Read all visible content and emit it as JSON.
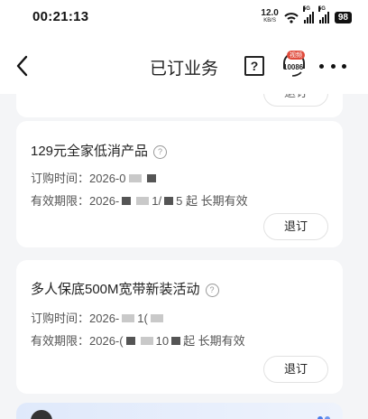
{
  "status_bar": {
    "time": "00:21:13",
    "speed_value": "12.0",
    "speed_unit": "KB/S",
    "sim_tag": "5G",
    "battery": "98"
  },
  "nav": {
    "title": "已订业务",
    "help_label": "?",
    "service_badge": "视频",
    "service_number": "10086"
  },
  "top_card": {
    "button_label": "退订"
  },
  "products": [
    {
      "name": "129元全家低消产品",
      "order_label": "订购时间：",
      "order_value": "2026-0",
      "validity_label": "有效期限：",
      "validity_prefix": "2026-",
      "validity_mid": "1/",
      "validity_suffix": "5 起 长期有效",
      "button_label": "退订"
    },
    {
      "name": "多人保底500M宽带新装活动",
      "order_label": "订购时间：",
      "order_value": "2026-",
      "order_tail": "1(",
      "validity_label": "有效期限：",
      "validity_prefix": "2026-(",
      "validity_mid": "10",
      "validity_suffix": "起 长期有效",
      "button_label": "退订"
    }
  ],
  "icons": {
    "back": "chevron-left-icon",
    "help": "question-box-icon",
    "service": "headset-icon",
    "more": "more-dots-icon",
    "info": "info-circle-icon",
    "wifi": "wifi-icon"
  }
}
